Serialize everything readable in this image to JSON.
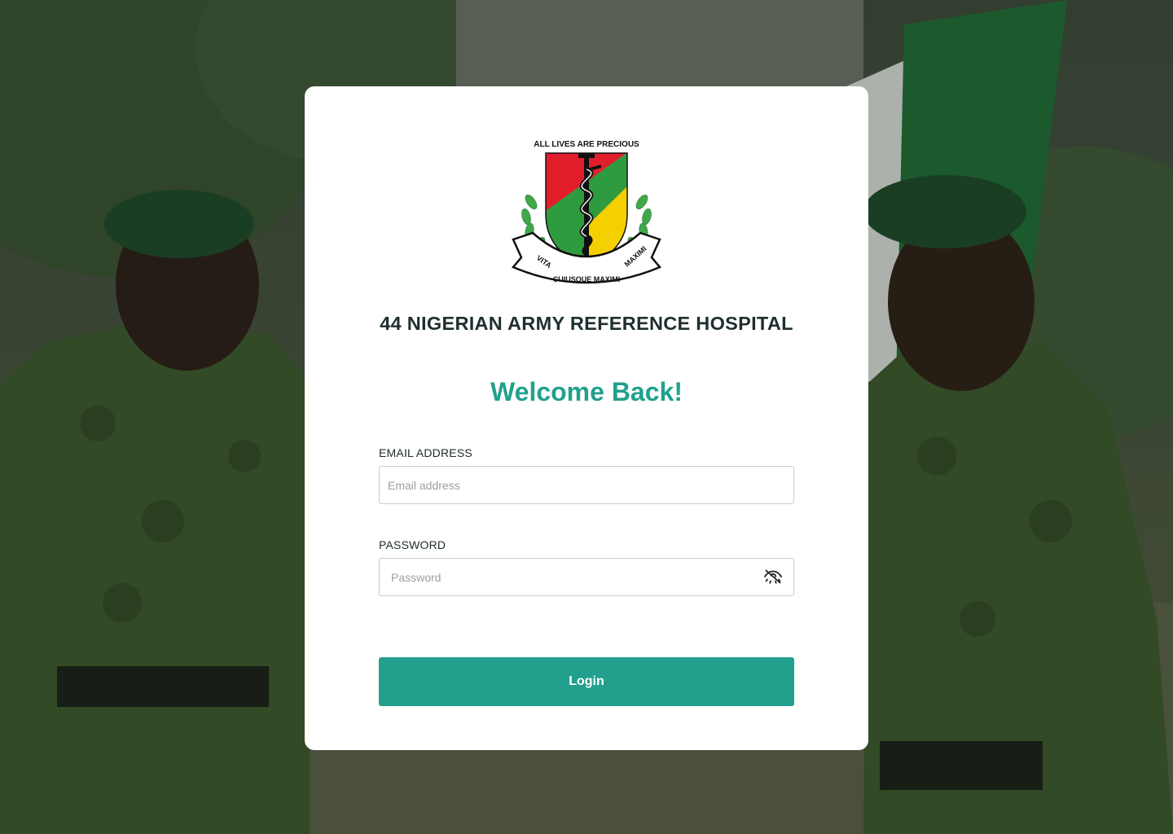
{
  "crest": {
    "motto_top": "ALL LIVES ARE PRECIOUS",
    "scroll_left": "VITA",
    "scroll_middle": "CUIUSQUE MAXIMI",
    "scroll_right": "MAXIMI"
  },
  "hospital_name": "44 NIGERIAN ARMY REFERENCE HOSPITAL",
  "welcome": "Welcome Back!",
  "form": {
    "email_label": "EMAIL ADDRESS",
    "email_placeholder": "Email address",
    "email_value": "",
    "password_label": "PASSWORD",
    "password_placeholder": "Password",
    "password_value": "",
    "password_toggle_icon": "eye-slash-icon",
    "login_label": "Login"
  },
  "colors": {
    "accent": "#22a08d",
    "heading": "#1f2f2f",
    "card": "#ffffff"
  }
}
